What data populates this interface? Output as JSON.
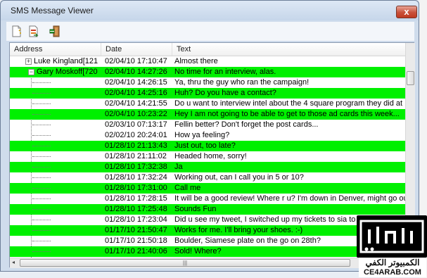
{
  "window": {
    "title": "SMS Message Viewer",
    "close_label": "x"
  },
  "toolbar": {
    "buttons": [
      {
        "name": "new-document-icon"
      },
      {
        "name": "export-icon"
      },
      {
        "name": "exit-icon"
      }
    ]
  },
  "columns": [
    "Address",
    "Date",
    "Text"
  ],
  "rows": [
    {
      "addr": "Luke Kingland[121",
      "date": "02/04/10 17:10:47",
      "text": "Almost there",
      "green": false,
      "type": "parent",
      "expander": "+"
    },
    {
      "addr": "Gary Moskoff[720",
      "date": "02/04/10 14:27:26",
      "text": "No time for an interview, alas.",
      "green": true,
      "type": "parent",
      "expander": "−"
    },
    {
      "addr": "",
      "date": "02/04/10 14:26:15",
      "text": "Ya, thru the guy who ran the campaign!",
      "green": false,
      "type": "child"
    },
    {
      "addr": "",
      "date": "02/04/10 14:25:16",
      "text": "Huh? Do you have a contact?",
      "green": true,
      "type": "child"
    },
    {
      "addr": "",
      "date": "02/04/10 14:21:55",
      "text": "Do u want to interview intel about the 4 square program they did at",
      "green": false,
      "type": "child"
    },
    {
      "addr": "",
      "date": "02/04/10 10:23:22",
      "text": "Hey I am not going to be able to get to those ad cards this week...",
      "green": true,
      "type": "child"
    },
    {
      "addr": "",
      "date": "02/03/10 07:13:17",
      "text": "Fellin better? Don't forget the post cards...",
      "green": false,
      "type": "child"
    },
    {
      "addr": "",
      "date": "02/02/10 20:24:01",
      "text": "How ya feeling?",
      "green": false,
      "type": "child"
    },
    {
      "addr": "",
      "date": "01/28/10 21:13:43",
      "text": "Just out, too late?",
      "green": true,
      "type": "child"
    },
    {
      "addr": "",
      "date": "01/28/10 21:11:02",
      "text": "Headed home, sorry!",
      "green": false,
      "type": "child"
    },
    {
      "addr": "",
      "date": "01/28/10 17:32:38",
      "text": "Ja",
      "green": true,
      "type": "child"
    },
    {
      "addr": "",
      "date": "01/28/10 17:32:24",
      "text": "Working out, can I call you in 5 or 10?",
      "green": false,
      "type": "child"
    },
    {
      "addr": "",
      "date": "01/28/10 17:31:00",
      "text": "Call me",
      "green": true,
      "type": "child"
    },
    {
      "addr": "",
      "date": "01/28/10 17:28:15",
      "text": "It will be a good review! Where r u? I'm down in Denver, might go out",
      "green": false,
      "type": "child"
    },
    {
      "addr": "",
      "date": "01/28/10 17:25:48",
      "text": "Sounds Fun",
      "green": true,
      "type": "child"
    },
    {
      "addr": "",
      "date": "01/28/10 17:23:04",
      "text": "Did u see my tweet, I switched up my tickets to sia to",
      "green": false,
      "type": "child"
    },
    {
      "addr": "",
      "date": "01/17/10 21:50:47",
      "text": "Works for me. I'll bring your shoes. :-)",
      "green": true,
      "type": "child"
    },
    {
      "addr": "",
      "date": "01/17/10 21:50:18",
      "text": "Boulder, Siamese plate on the go on 28th?",
      "green": false,
      "type": "child"
    },
    {
      "addr": "",
      "date": "01/17/10 21:40:06",
      "text": "Sold!  Where?",
      "green": true,
      "type": "child"
    }
  ],
  "scroll": {
    "left_arrow": "◂",
    "right_arrow": "▸",
    "grip": "|||"
  },
  "watermark": {
    "arabic": "الكمبيوتر الكفي",
    "site": "CE4ARAB.COM"
  },
  "colors": {
    "row_highlight": "#00f000",
    "window_frame": "#cfdcec",
    "close_button": "#c9503a"
  }
}
